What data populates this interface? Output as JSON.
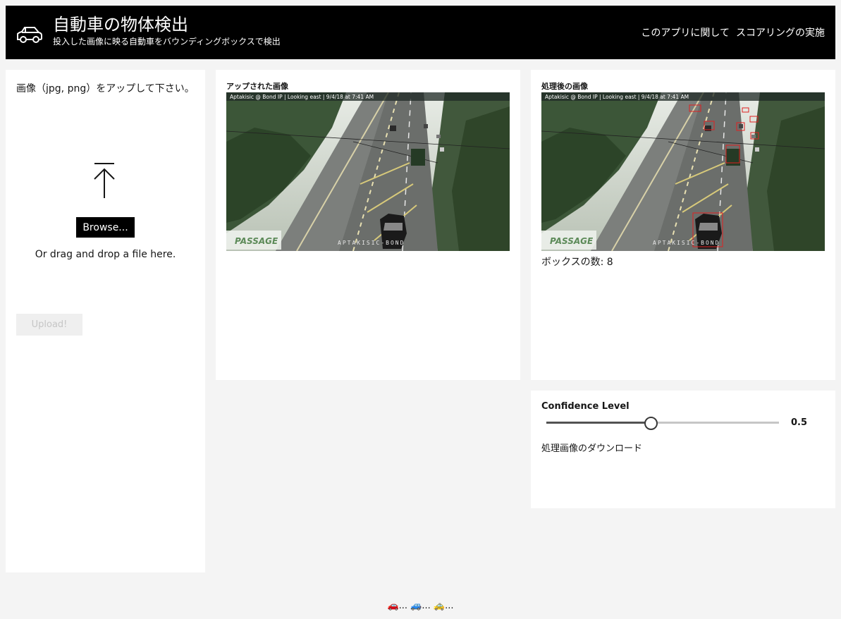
{
  "header": {
    "title": "自動車の物体検出",
    "subtitle": "投入した画像に映る自動車をバウンディングボックスで検出",
    "logo_icon": "car-icon",
    "nav": [
      "このアプリに関して",
      "スコアリングの実施"
    ]
  },
  "upload": {
    "prompt": "画像（jpg, png）をアップして下さい。",
    "icon": "upload-arrow-icon",
    "browse_label": "Browse...",
    "drop_text": "Or drag and drop a file here.",
    "upload_label": "Upload!"
  },
  "uploaded": {
    "label": "アップされた画像",
    "caption": "Aptakisic @ Bond IP | Looking east | 9/4/18 at 7:41 AM",
    "watermark": "PASSAGE",
    "road_text": "APTAKISIC-BOND"
  },
  "processed": {
    "label": "処理後の画像",
    "caption": "Aptakisic @ Bond IP | Looking east | 9/4/18 at 7:41 AM",
    "watermark": "PASSAGE",
    "road_text": "APTAKISIC-BOND",
    "box_count_text": "ボックスの数: 8"
  },
  "controls": {
    "confidence_label": "Confidence Level",
    "confidence_value": 0.5,
    "confidence_text": "0.5",
    "download_label": "処理画像のダウンロード"
  },
  "footer": {
    "text": "🚗... 🚙... 🚕..."
  },
  "colors": {
    "header_bg": "#000000",
    "page_bg": "#f4f4f4",
    "box_color": "#e02020"
  }
}
